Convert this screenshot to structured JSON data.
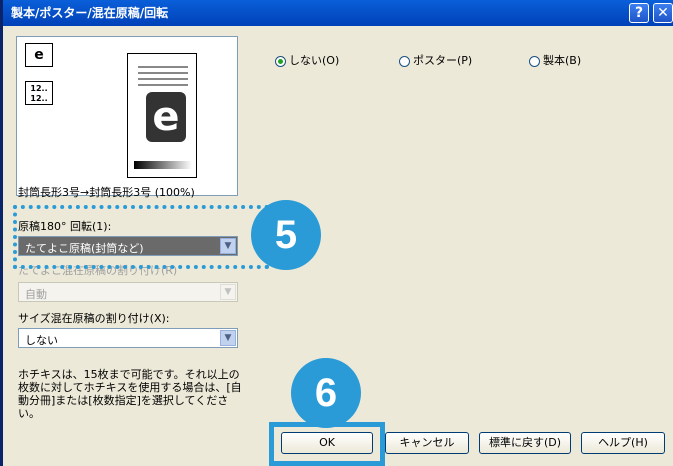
{
  "window": {
    "title": "製本/ポスター/混在原稿/回転",
    "help_btn": "?",
    "close_btn": "✕"
  },
  "preview": {
    "paper_label": "封筒長形3号→封筒長形3号 (100%)",
    "big_icon_letter": "e",
    "small_icon_letter": "e",
    "page_numbers": [
      "12..",
      "12.."
    ]
  },
  "left": {
    "rotate_label": "原稿180° 回転(1):",
    "rotate_value": "たてよこ原稿(封筒など)",
    "mixed_label": "たてよこ混在原稿の割り付け(R)",
    "mixed_value": "自動",
    "size_label": "サイズ混在原稿の割り付け(X):",
    "size_value": "しない",
    "note": "ホチキスは、15枚まで可能です。それ以上の枚数に対してホチキスを使用する場合は、[自動分冊]または[枚数指定]を選択してください。"
  },
  "options": {
    "none": "しない(O)",
    "poster": "ポスター(P)",
    "book": "製本(B)",
    "selected": "none"
  },
  "buttons": {
    "ok": "OK",
    "cancel": "キャンセル",
    "reset": "標準に戻す(D)",
    "help": "ヘルプ(H)"
  },
  "callouts": {
    "five": "5",
    "six": "6"
  },
  "colors": {
    "accent": "#2a9bd6",
    "titlebar": "#0a5fd8"
  }
}
